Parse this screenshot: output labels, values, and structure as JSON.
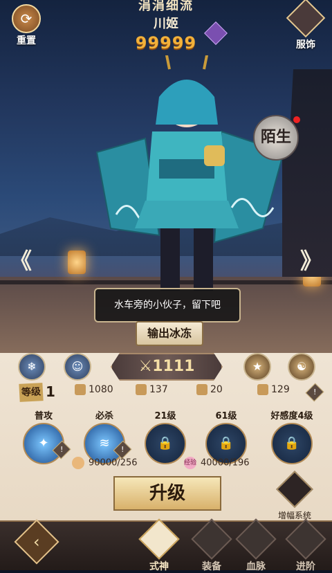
{
  "header": {
    "title": "涓涓细流",
    "hero_name": "川姬",
    "power": "99999",
    "reset_label": "重置",
    "outfit_label": "服饰"
  },
  "scene": {
    "stranger_label": "陌生",
    "speech": "水车旁的小伙子，留下吧",
    "role": "输出冰冻",
    "prev_arrow": "《",
    "next_arrow": "》"
  },
  "panel": {
    "attack_value": "1111",
    "level_tag": "等级",
    "level_value": "1",
    "stats": [
      {
        "name": "water-stat-icon",
        "value": "1080"
      },
      {
        "name": "blade-stat-icon",
        "value": "137"
      },
      {
        "name": "armor-stat-icon",
        "value": "20"
      },
      {
        "name": "boot-stat-icon",
        "value": "129"
      }
    ],
    "info_mark": "!",
    "skills": [
      {
        "name": "普攻",
        "locked": false,
        "badge": "!"
      },
      {
        "name": "必杀",
        "locked": false,
        "badge": "!"
      },
      {
        "name": "21级",
        "locked": true
      },
      {
        "name": "61级",
        "locked": true
      },
      {
        "name": "好感度4级",
        "locked": true
      }
    ],
    "resource_coin": "90000/256",
    "resource_exp_label": "经验",
    "resource_exp": "40000/196",
    "upgrade_label": "升级",
    "boost_label": "增幅系统"
  },
  "nav": {
    "back": "‹",
    "items": [
      {
        "label": "式神",
        "active": true
      },
      {
        "label": "装备",
        "active": false
      },
      {
        "label": "血脉",
        "active": false
      },
      {
        "label": "进阶",
        "active": false
      }
    ]
  },
  "colors": {
    "gold": "#f2b13a",
    "panel": "#efe4d4",
    "navbar": "#2a211f"
  }
}
